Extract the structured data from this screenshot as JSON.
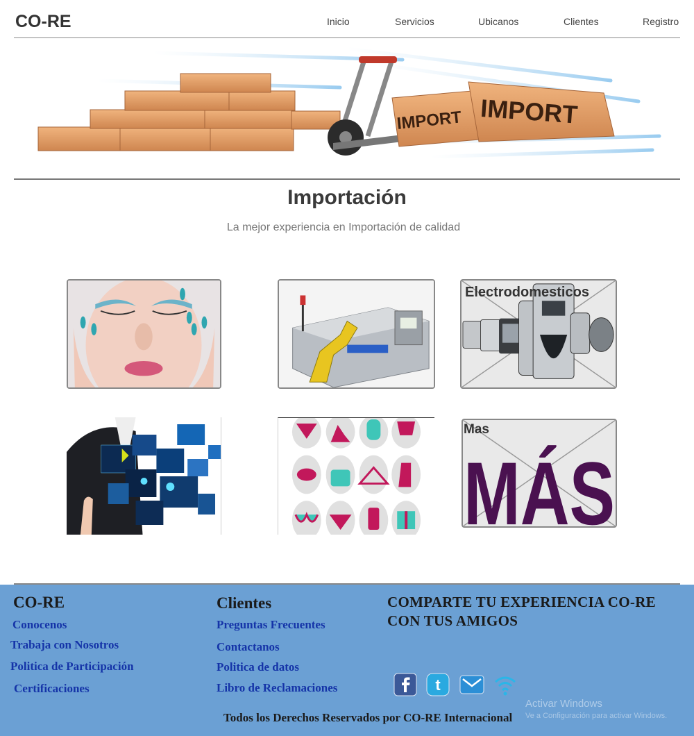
{
  "header": {
    "logo": "CO-RE",
    "nav": [
      "Inicio",
      "Servicios",
      "Ubicanos",
      "Clientes",
      "Registro"
    ]
  },
  "banner": {
    "box_text_1": "IMPORT",
    "box_text_2": "IMPORT"
  },
  "main": {
    "title": "Importación",
    "subtitle": "La mejor experiencia en Importación de calidad"
  },
  "tiles": {
    "electro_label": "Electrodomesticos",
    "mas_label": "Mas",
    "mas_big": "MÁS"
  },
  "footer": {
    "col1": {
      "title": "CO-RE",
      "links": [
        "Conocenos",
        "Trabaja con Nosotros",
        "Politica de Participación",
        "Certificaciones"
      ]
    },
    "col2": {
      "title": "Clientes",
      "links": [
        "Preguntas Frecuentes",
        "Contactanos",
        "Politica de datos",
        "Libro de Reclamaciones"
      ]
    },
    "share": {
      "line1": "COMPARTE TU EXPERIENCIA CO-RE",
      "line2": "CON TUS AMIGOS"
    },
    "copyright": "Todos los Derechos Reservados por CO-RE Internacional",
    "social_icons": [
      "facebook-icon",
      "twitter-icon",
      "mail-icon",
      "wifi-icon"
    ]
  },
  "watermark": {
    "line1": "Activar Windows",
    "line2": "Ve a Configuración para activar Windows."
  },
  "colors": {
    "footer_bg": "#6ba0d4",
    "link": "#1534a8",
    "mas_purple": "#4a1150",
    "accent_pink": "#c2185b",
    "accent_teal": "#3fc6b8"
  }
}
